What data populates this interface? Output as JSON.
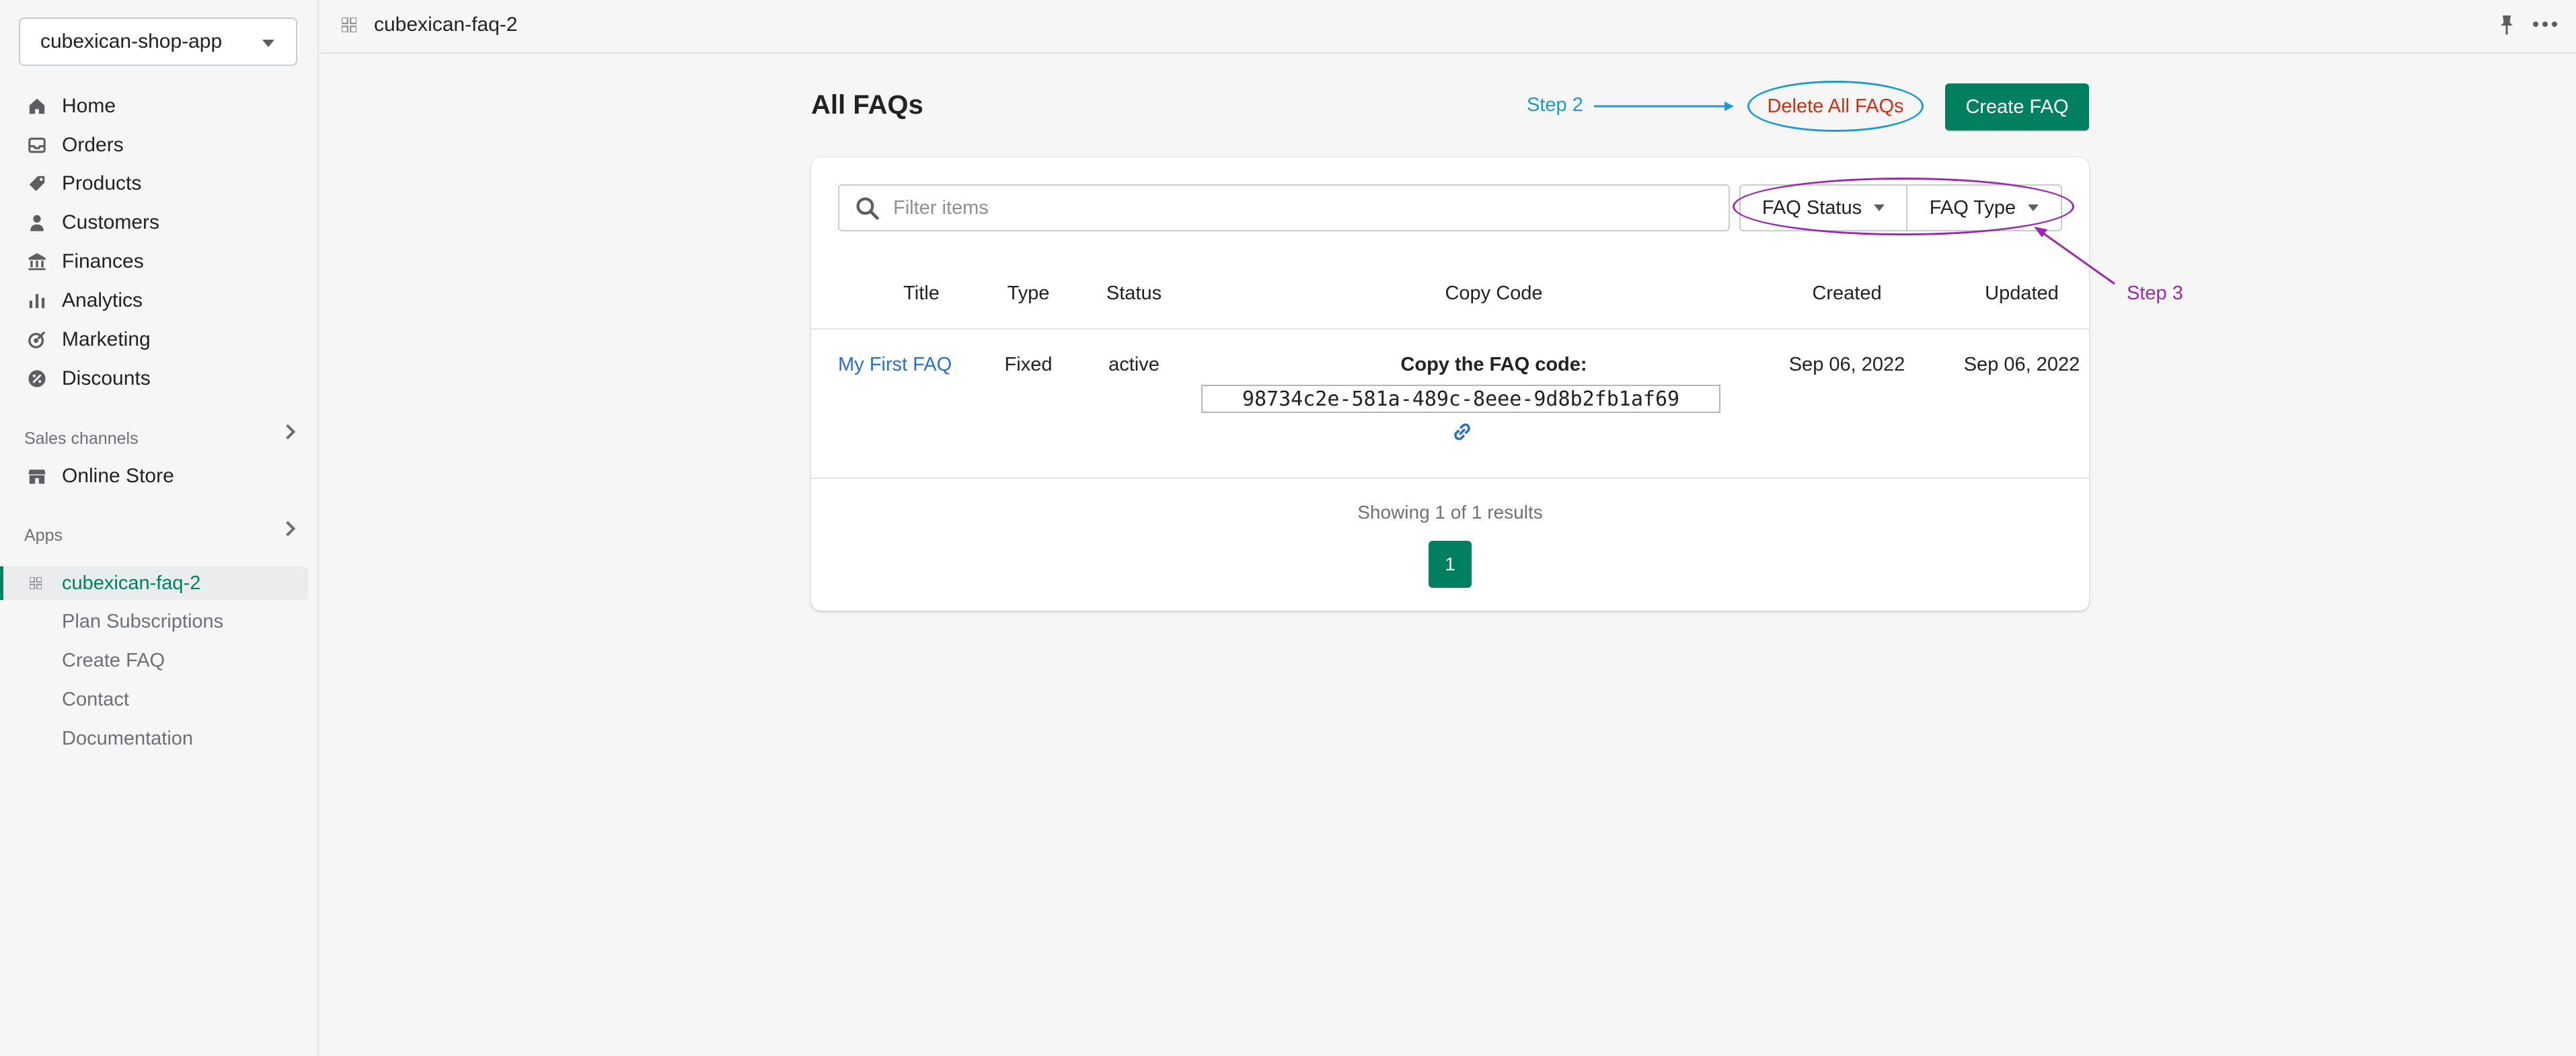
{
  "sidebar": {
    "store_name": "cubexican-shop-app",
    "nav": [
      {
        "label": "Home",
        "icon": "home-icon"
      },
      {
        "label": "Orders",
        "icon": "inbox-icon"
      },
      {
        "label": "Products",
        "icon": "tag-icon"
      },
      {
        "label": "Customers",
        "icon": "person-icon"
      },
      {
        "label": "Finances",
        "icon": "bank-icon"
      },
      {
        "label": "Analytics",
        "icon": "bar-chart-icon"
      },
      {
        "label": "Marketing",
        "icon": "target-icon"
      },
      {
        "label": "Discounts",
        "icon": "discount-icon"
      }
    ],
    "sales_channels_label": "Sales channels",
    "online_store_label": "Online Store",
    "apps_label": "Apps",
    "active_app": "cubexican-faq-2",
    "app_subitems": [
      "Plan Subscriptions",
      "Create FAQ",
      "Contact",
      "Documentation"
    ]
  },
  "topbar": {
    "title": "cubexican-faq-2"
  },
  "main": {
    "page_title": "All FAQs",
    "delete_label": "Delete All FAQs",
    "create_label": "Create FAQ",
    "filter_placeholder": "Filter items",
    "faq_status_label": "FAQ Status",
    "faq_type_label": "FAQ Type",
    "columns": [
      "Title",
      "Type",
      "Status",
      "Copy Code",
      "Created",
      "Updated"
    ],
    "rows": [
      {
        "title": "My First FAQ",
        "type": "Fixed",
        "status": "active",
        "copy_heading": "Copy the FAQ code:",
        "code": "98734c2e-581a-489c-8eee-9d8b2fb1af69",
        "created": "Sep 06, 2022",
        "updated": "Sep 06, 2022"
      }
    ],
    "showing_text": "Showing 1 of 1 results",
    "current_page": "1"
  },
  "annotations": {
    "step2": "Step 2",
    "step3": "Step 3",
    "step2_color": "#1a9ad6",
    "step3_color": "#9c27b0"
  },
  "colors": {
    "primary": "#008060",
    "critical": "#d72c0d",
    "link": "#2c6ecb"
  }
}
